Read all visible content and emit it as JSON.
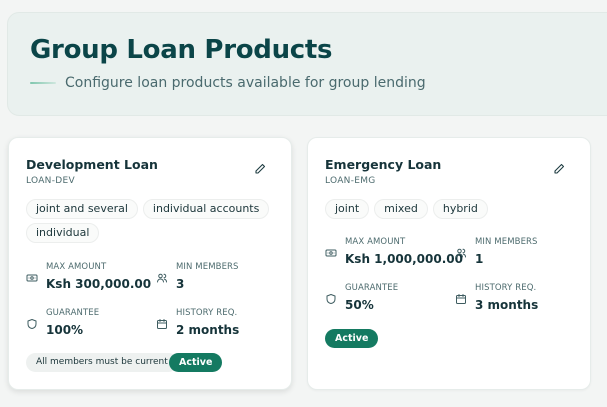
{
  "header": {
    "title": "Group Loan Products",
    "subtitle": "Configure loan products available for group lending"
  },
  "products": [
    {
      "name": "Development Loan",
      "code": "LOAN-DEV",
      "tags": [
        "joint and several",
        "individual accounts",
        "individual"
      ],
      "stats": {
        "max_amount": {
          "label": "MAX AMOUNT",
          "value": "Ksh 300,000.00"
        },
        "min_members": {
          "label": "MIN MEMBERS",
          "value": "3"
        },
        "guarantee": {
          "label": "GUARANTEE",
          "value": "100%"
        },
        "history": {
          "label": "HISTORY REQ.",
          "value": "2 months"
        }
      },
      "note": "All members must be current",
      "status": "Active"
    },
    {
      "name": "Emergency Loan",
      "code": "LOAN-EMG",
      "tags": [
        "joint",
        "mixed",
        "hybrid"
      ],
      "stats": {
        "max_amount": {
          "label": "MAX AMOUNT",
          "value": "Ksh 1,000,000.00"
        },
        "min_members": {
          "label": "MIN MEMBERS",
          "value": "1"
        },
        "guarantee": {
          "label": "GUARANTEE",
          "value": "50%"
        },
        "history": {
          "label": "HISTORY REQ.",
          "value": "3 months"
        }
      },
      "status": "Active"
    }
  ],
  "icons": {
    "edit": "pencil-icon",
    "max_amount": "banknote-icon",
    "min_members": "users-icon",
    "guarantee": "shield-icon",
    "history": "calendar-icon"
  },
  "colors": {
    "title": "#0b4548",
    "accent": "#147a61",
    "header_bg": "#eaf1ef"
  }
}
